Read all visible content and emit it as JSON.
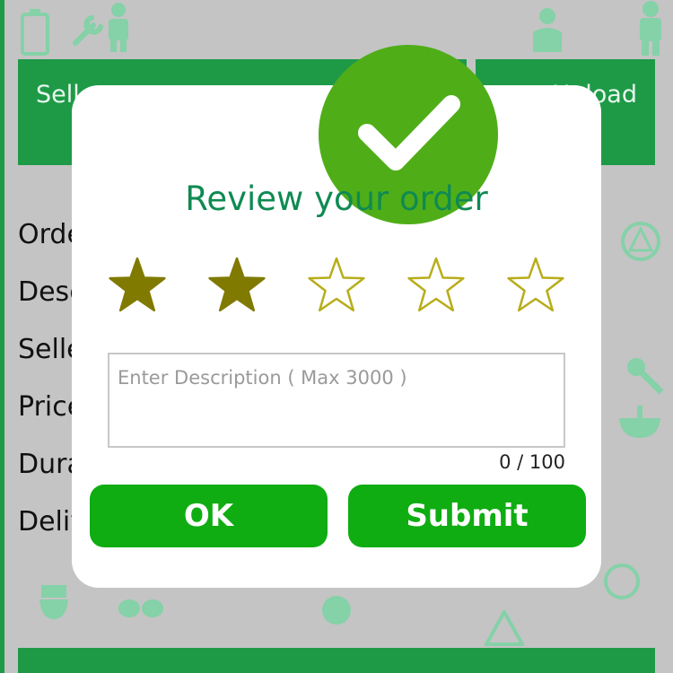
{
  "background": {
    "header_left_text": "Seller",
    "header_right_text": "Upload",
    "labels": [
      "Order",
      "Description",
      "Seller",
      "Price",
      "Duration",
      "Delivery"
    ]
  },
  "dialog": {
    "title": "Review your order",
    "rating": {
      "value": 2,
      "max": 5,
      "filled_color": "#807a00",
      "empty_color": "#b7ad1a"
    },
    "description": {
      "placeholder": "Enter Description ( Max 3000 )",
      "value": ""
    },
    "counter": "0 / 100",
    "buttons": {
      "ok": "OK",
      "submit": "Submit"
    }
  },
  "colors": {
    "accent_green": "#0fad12",
    "badge_green": "#4fae18",
    "title_green": "#0f8a52",
    "bar_green": "#1e9a47"
  }
}
